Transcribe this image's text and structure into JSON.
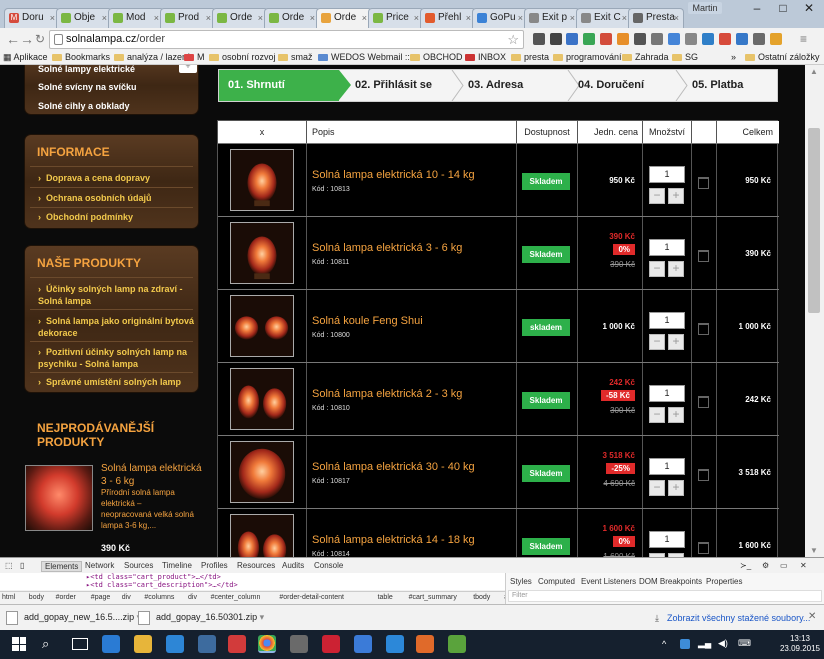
{
  "browser": {
    "tabs": [
      {
        "label": "Doru",
        "color": "#d54b3d",
        "glyph": "M"
      },
      {
        "label": "Obje",
        "color": "#7bb743",
        "glyph": ""
      },
      {
        "label": "Mod",
        "color": "#7bb743",
        "glyph": ""
      },
      {
        "label": "Prod",
        "color": "#7bb743",
        "glyph": ""
      },
      {
        "label": "Orde",
        "color": "#7bb743",
        "glyph": ""
      },
      {
        "label": "Orde",
        "color": "#7bb743",
        "glyph": ""
      },
      {
        "label": "Orde",
        "color": "#e8a33d",
        "glyph": ""
      },
      {
        "label": "Price",
        "color": "#7bb743",
        "glyph": ""
      },
      {
        "label": "Přehl",
        "color": "#e25b2d",
        "glyph": ""
      },
      {
        "label": "GoPu",
        "color": "#3b82d6",
        "glyph": ""
      },
      {
        "label": "Exit p",
        "color": "#888888",
        "glyph": ""
      },
      {
        "label": "Exit C",
        "color": "#888888",
        "glyph": ""
      },
      {
        "label": "Presta",
        "color": "#666666",
        "glyph": ""
      }
    ],
    "profile": "Martin",
    "url_host": "solnalampa.cz",
    "url_path": "/order",
    "bookmarks": {
      "apps": "Aplikace",
      "items": [
        "Bookmarks",
        "analýza / lazení",
        "M",
        "osobní rozvoj",
        "smaž",
        "WEDOS Webmail ::...",
        "OBCHOD",
        "INBOX",
        "presta",
        "programování",
        "Zahrada",
        "SG"
      ],
      "more": "»",
      "other": "Ostatní záložky"
    }
  },
  "sidebar": {
    "top_links": [
      "Solné lampy elektrické",
      "Solné svícny na svíčku",
      "Solné cihly a obklady"
    ],
    "info": {
      "title": "INFORMACE",
      "links": [
        "Doprava a cena dopravy",
        "Ochrana osobních údajů",
        "Obchodní podmínky"
      ]
    },
    "products": {
      "title": "NAŠE PRODUKTY",
      "links": [
        [
          "Účinky solných lamp na zdraví -",
          "Solná lampa"
        ],
        [
          "Solná lampa jako originální bytová",
          "dekorace"
        ],
        [
          "Pozitivní účinky solných lamp na",
          "psychiku - Solná lampa"
        ],
        [
          "Správné umístění solných lamp",
          ""
        ]
      ]
    },
    "bestsellers": {
      "title": [
        "NEJPRODÁVANĚJŠÍ",
        "PRODUKTY"
      ],
      "name": [
        "Solná lampa elektrická",
        "3 - 6 kg"
      ],
      "desc": [
        "Přírodní solná lampa",
        "elektrická –",
        "neopracovaná velká solná",
        "lampa 3-6 kg,..."
      ],
      "price": "390 Kč"
    }
  },
  "checkout": {
    "steps": [
      "01. Shrnutí",
      "02. Přihlásit se",
      "03. Adresa",
      "04. Doručení",
      "05. Platba"
    ],
    "headers": [
      "x",
      "Popis",
      "Dostupnost",
      "Jedn. cena",
      "Množství",
      "",
      "Celkem"
    ],
    "rows": [
      {
        "name": "Solná lampa elektrická 10 - 14 kg",
        "code": "Kód : 10813",
        "stock": "Skladem",
        "price": "950 Kč",
        "discount": "",
        "old": "",
        "qty": "1",
        "total": "950 Kč",
        "thumb": "single"
      },
      {
        "name": "Solná lampa elektrická 3 - 6 kg",
        "code": "Kód : 10811",
        "stock": "Skladem",
        "price": "390 Kč",
        "discount": "0%",
        "old": "390 Kč",
        "qty": "1",
        "total": "390 Kč",
        "thumb": "single"
      },
      {
        "name": "Solná koule Feng Shui",
        "code": "Kód : 10800",
        "stock": "skladem",
        "price": "1 000 Kč",
        "discount": "",
        "old": "",
        "qty": "1",
        "total": "1 000 Kč",
        "thumb": "balls"
      },
      {
        "name": "Solná lampa elektrická 2 - 3 kg",
        "code": "Kód : 10810",
        "stock": "Skladem",
        "price": "242 Kč",
        "discount": "-58 Kč",
        "old": "300 Kč",
        "qty": "1",
        "total": "242 Kč",
        "thumb": "double"
      },
      {
        "name": "Solná lampa elektrická 30 - 40 kg",
        "code": "Kód : 10817",
        "stock": "Skladem",
        "price": "3 518 Kč",
        "discount": "-25%",
        "old": "4 690 Kč",
        "qty": "1",
        "total": "3 518 Kč",
        "thumb": "big"
      },
      {
        "name": "Solná lampa elektrická 14 - 18 kg",
        "code": "Kód : 10814",
        "stock": "Skladem",
        "price": "1 600 Kč",
        "discount": "0%",
        "old": "1 600 Kč",
        "qty": "1",
        "total": "1 600 Kč",
        "thumb": "double"
      }
    ],
    "minus": "−",
    "plus": "+"
  },
  "devtools": {
    "tabs": [
      "Elements",
      "Network",
      "Sources",
      "Timeline",
      "Profiles",
      "Resources",
      "Audits",
      "Console"
    ],
    "code": [
      "▸<td class=\"cart_product\">…</td>",
      "▸<td class=\"cart_description\">…</td>"
    ],
    "crumbs": [
      "html",
      "body",
      "#order",
      "#page",
      "div",
      "#columns",
      "div",
      "#center_column",
      "#order-detail-content",
      "table",
      "#cart_summary",
      "tbody",
      "#product_14_0_0_147",
      "td.cart_unit"
    ],
    "style_tabs": [
      "Styles",
      "Computed",
      "Event Listeners",
      "DOM Breakpoints",
      "Properties"
    ],
    "filter": "Filter"
  },
  "downloads": {
    "items": [
      "add_gopay_new_16.5....zip",
      "add_gopay_16.50301.zip"
    ],
    "show_all": "Zobrazit všechny stažené soubory..."
  },
  "taskbar": {
    "time": "13:13",
    "date": "23.09.2015"
  }
}
